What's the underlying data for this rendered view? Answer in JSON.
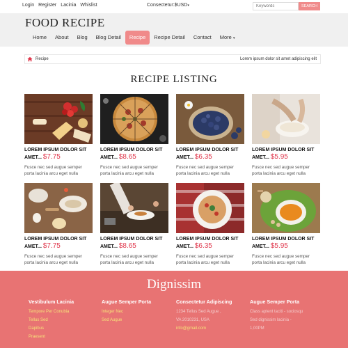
{
  "topbar": {
    "links": [
      "Login",
      "Register",
      "Lacinia",
      "Whislist"
    ],
    "currency": "Consectetur:$USD",
    "search_placeholder": "Keywords",
    "search_button": "SEARCH"
  },
  "header": {
    "logo": "FOOD RECIPE",
    "nav": [
      {
        "label": "Home",
        "active": false
      },
      {
        "label": "About",
        "active": false
      },
      {
        "label": "Blog",
        "active": false
      },
      {
        "label": "Blog Detail",
        "active": false
      },
      {
        "label": "Recipe",
        "active": true
      },
      {
        "label": "Recipe Detail",
        "active": false
      },
      {
        "label": "Contact",
        "active": false
      },
      {
        "label": "More",
        "active": false
      }
    ]
  },
  "breadcrumb": {
    "current": "Recipe",
    "note": "Lorem ipsum dolor sit amet adipiscing elit"
  },
  "page_title": "RECIPE LISTING",
  "recipes": [
    {
      "title": "LOREM IPSUM DOLOR SIT AMET...",
      "price": "$7.75",
      "desc": "Fusce nec sed augue semper porta lacinia arcu eget nulla",
      "image": "pasta-ingredients"
    },
    {
      "title": "LOREM IPSUM DOLOR SIT AMET...",
      "price": "$8.65",
      "desc": "Fusce nec sed augue semper porta lacinia arcu eget nulla",
      "image": "pizza"
    },
    {
      "title": "LOREM IPSUM DOLOR SIT AMET...",
      "price": "$6.35",
      "desc": "Fusce nec sed augue semper porta lacinia arcu eget nulla",
      "image": "blueberries"
    },
    {
      "title": "LOREM IPSUM DOLOR SIT AMET...",
      "price": "$5.95",
      "desc": "Fusce nec sed augue semper porta lacinia arcu eget nulla",
      "image": "baking-bowl"
    },
    {
      "title": "LOREM IPSUM DOLOR SIT AMET...",
      "price": "$7.75",
      "desc": "Fusce nec sed augue semper porta lacinia arcu eget nulla",
      "image": "flour-eggs"
    },
    {
      "title": "LOREM IPSUM DOLOR SIT AMET...",
      "price": "$8.65",
      "desc": "Fusce nec sed augue semper porta lacinia arcu eget nulla",
      "image": "chef-plating"
    },
    {
      "title": "LOREM IPSUM DOLOR SIT AMET...",
      "price": "$6.35",
      "desc": "Fusce nec sed augue semper porta lacinia arcu eget nulla",
      "image": "pasta-plate"
    },
    {
      "title": "LOREM IPSUM DOLOR SIT AMET...",
      "price": "$5.95",
      "desc": "Fusce nec sed augue semper porta lacinia arcu eget nulla",
      "image": "soup-bowl"
    }
  ],
  "footer": {
    "title": "Dignissim",
    "columns": [
      {
        "heading": "Vestibulum Lacinia",
        "lines": [
          "Tempore Per Conubia",
          "Tellus Sed",
          "Dapibus",
          "Praesent"
        ],
        "muted": false
      },
      {
        "heading": "Augue Semper Porta",
        "lines": [
          "Integer Nec",
          "Sed Augue"
        ],
        "muted": false
      },
      {
        "heading": "Consectetur Adipiscing",
        "lines": [
          "1234 Tellus Sed Augue ,",
          "VA 2010231, USA",
          "info@gmail.com"
        ],
        "muted": false
      },
      {
        "heading": "Augue Semper Porta",
        "lines": [
          "Class aptent taciti - sociosqu",
          "Sed dignissim lacinia -",
          "1,00PM"
        ],
        "muted": true
      }
    ]
  },
  "colors": {
    "accent": "#f08a8a",
    "price": "#e0384d",
    "footer_bg": "#e87373",
    "footer_link": "#f6e27a"
  }
}
